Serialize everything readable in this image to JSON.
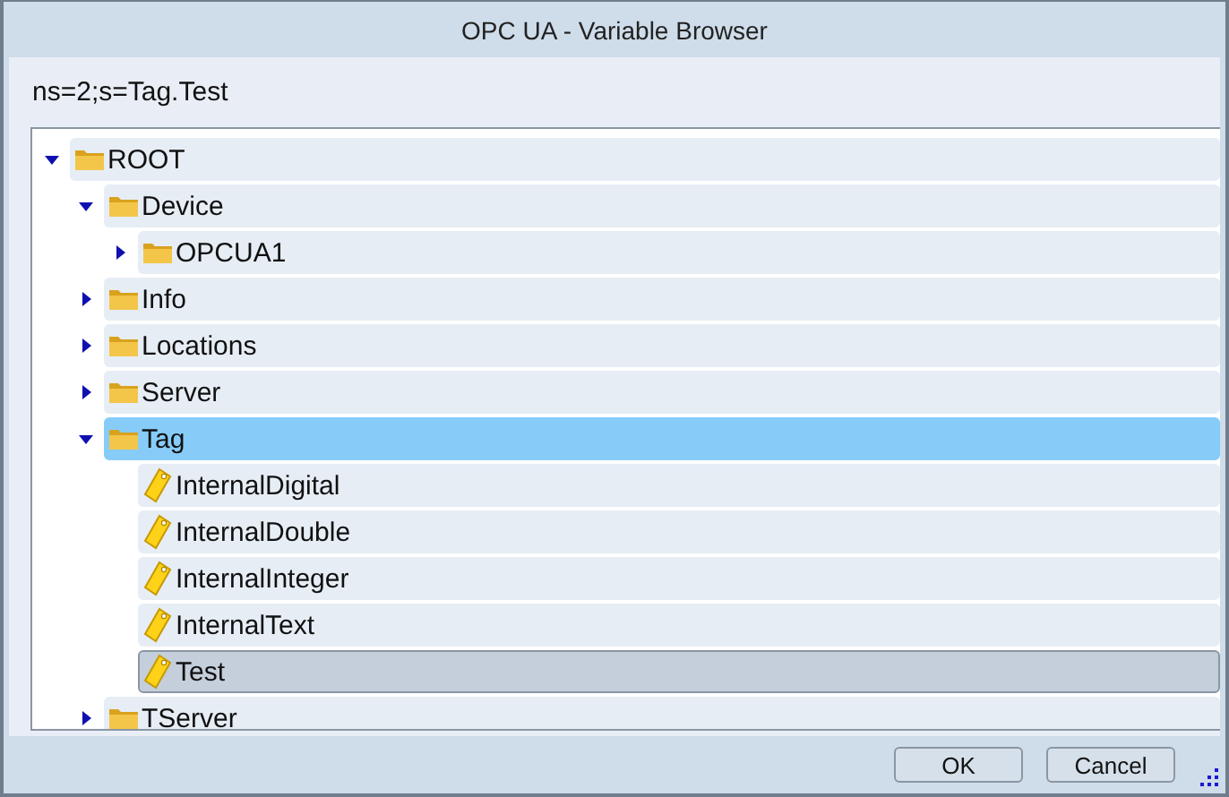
{
  "window": {
    "title": "OPC UA - Variable Browser"
  },
  "path": "ns=2;s=Tag.Test",
  "tree": [
    {
      "label": "ROOT",
      "kind": "folder",
      "expanded": true,
      "selected": false,
      "hovered": false,
      "children": [
        {
          "label": "Device",
          "kind": "folder",
          "expanded": true,
          "selected": false,
          "hovered": false,
          "children": [
            {
              "label": "OPCUA1",
              "kind": "folder",
              "expanded": false,
              "selected": false,
              "hovered": false
            }
          ]
        },
        {
          "label": "Info",
          "kind": "folder",
          "expanded": false,
          "selected": false,
          "hovered": false
        },
        {
          "label": "Locations",
          "kind": "folder",
          "expanded": false,
          "selected": false,
          "hovered": false
        },
        {
          "label": "Server",
          "kind": "folder",
          "expanded": false,
          "selected": false,
          "hovered": false
        },
        {
          "label": "Tag",
          "kind": "folder",
          "expanded": true,
          "selected": false,
          "hovered": true,
          "children": [
            {
              "label": "InternalDigital",
              "kind": "tag",
              "selected": false,
              "hovered": false
            },
            {
              "label": "InternalDouble",
              "kind": "tag",
              "selected": false,
              "hovered": false
            },
            {
              "label": "InternalInteger",
              "kind": "tag",
              "selected": false,
              "hovered": false
            },
            {
              "label": "InternalText",
              "kind": "tag",
              "selected": false,
              "hovered": false
            },
            {
              "label": "Test",
              "kind": "tag",
              "selected": true,
              "hovered": false
            }
          ]
        },
        {
          "label": "TServer",
          "kind": "folder",
          "expanded": false,
          "selected": false,
          "hovered": false
        }
      ]
    }
  ],
  "buttons": [
    "OK",
    "Cancel"
  ]
}
